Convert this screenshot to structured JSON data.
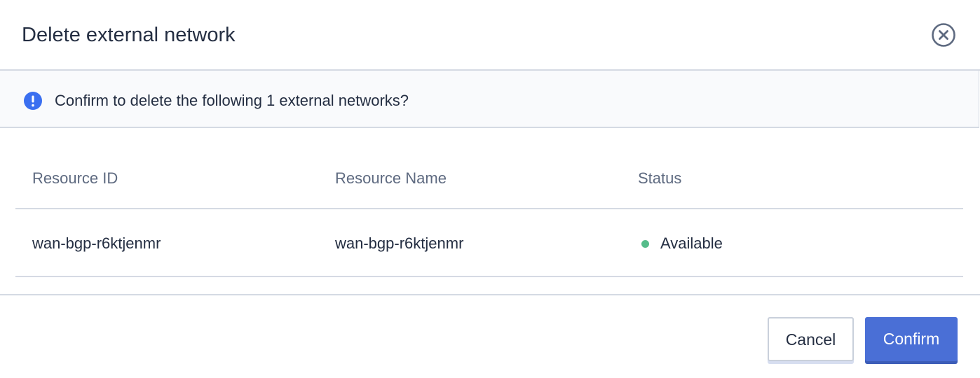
{
  "dialog": {
    "title": "Delete external network",
    "notice": "Confirm to delete the following 1 external networks?",
    "colors": {
      "primary": "#4a6fd6",
      "info_icon": "#3a6ff0",
      "status_available": "#55bc8a"
    }
  },
  "table": {
    "headers": [
      "Resource ID",
      "Resource Name",
      "Status"
    ],
    "rows": [
      {
        "id": "wan-bgp-r6ktjenmr",
        "name": "wan-bgp-r6ktjenmr",
        "status": "Available"
      }
    ]
  },
  "footer": {
    "cancel_label": "Cancel",
    "confirm_label": "Confirm"
  },
  "icons": {
    "close": "close-icon",
    "info": "info-icon",
    "status": "status-dot-icon"
  }
}
